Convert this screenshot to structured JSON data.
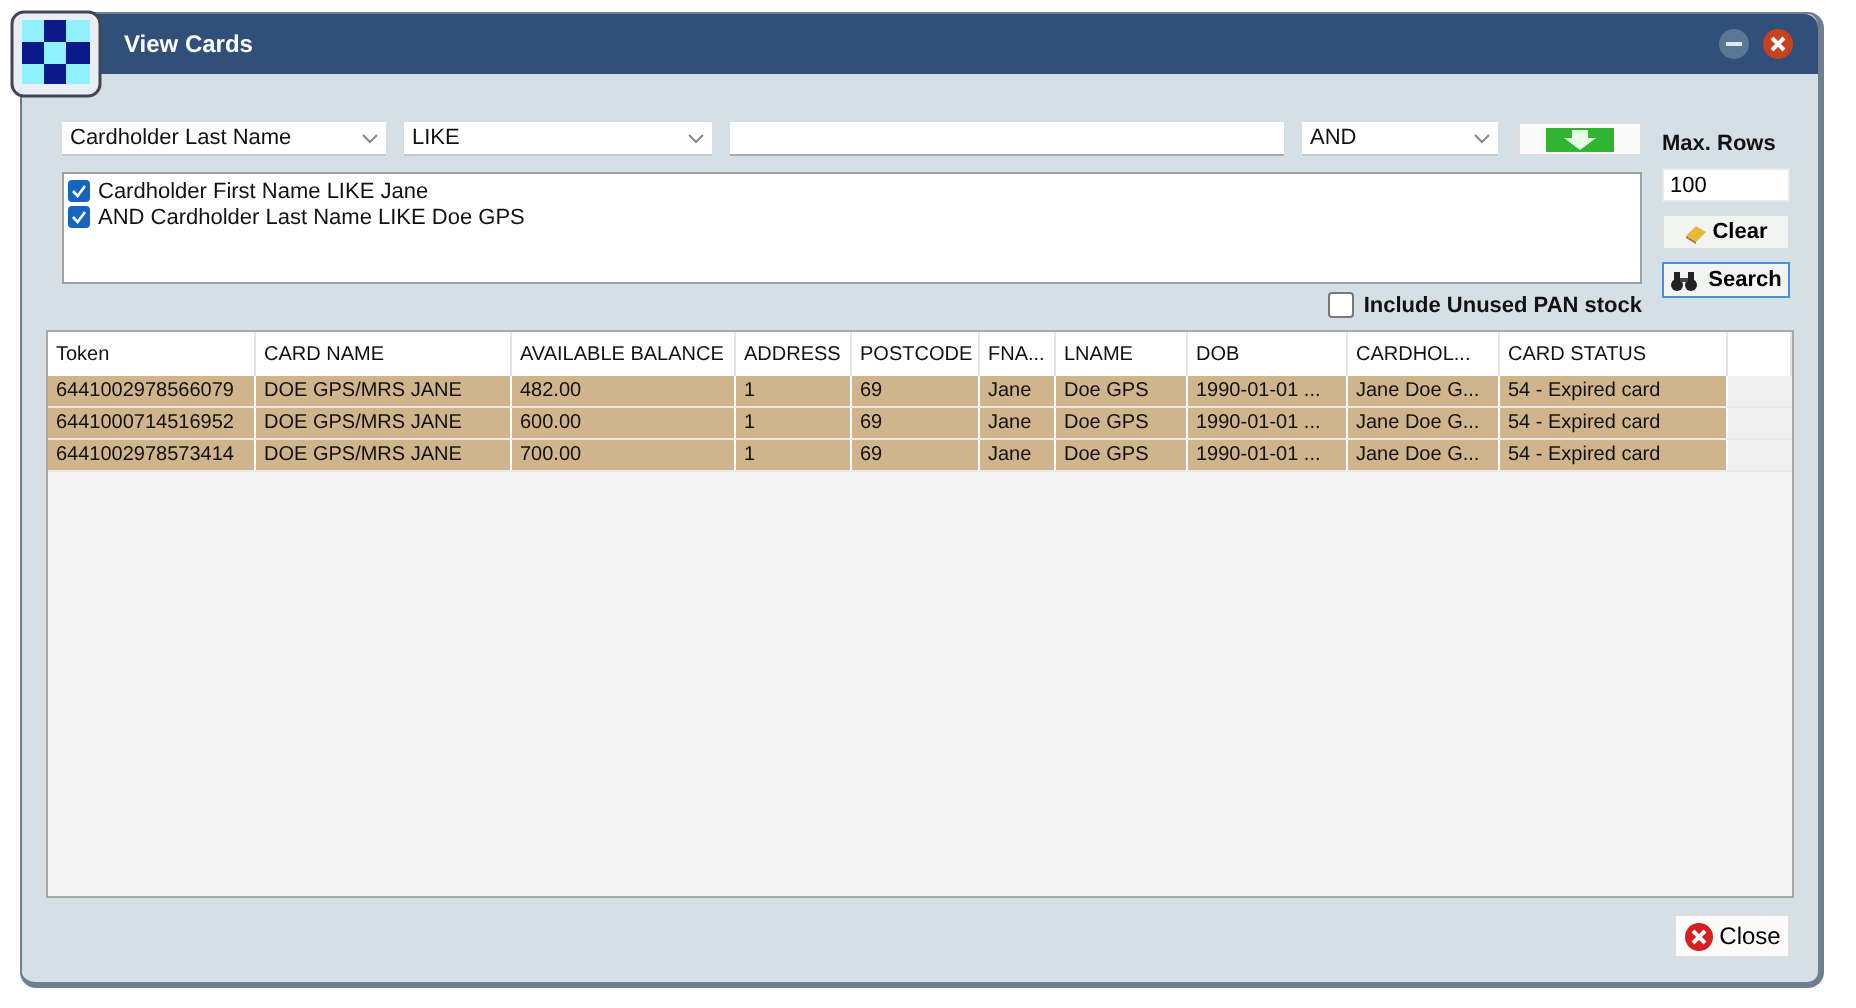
{
  "window": {
    "title": "View Cards"
  },
  "filter": {
    "field": "Cardholder Last Name",
    "operator": "LIKE",
    "join": "AND"
  },
  "conditions": [
    {
      "text": "Cardholder First Name LIKE Jane",
      "checked": true
    },
    {
      "text": "AND  Cardholder Last Name LIKE Doe GPS",
      "checked": true
    }
  ],
  "max_rows": {
    "label": "Max. Rows",
    "value": "100"
  },
  "clear_button": "Clear",
  "include_unused": {
    "label": "Include Unused PAN stock",
    "checked": false
  },
  "search_button": "Search",
  "table": {
    "columns": [
      "Token",
      "CARD NAME",
      "AVAILABLE BALANCE",
      "ADDRESS",
      "POSTCODE",
      "FNA...",
      "LNAME",
      "DOB",
      "CARDHOL...",
      "CARD STATUS"
    ],
    "rows": [
      {
        "selected": true,
        "cells": [
          "6441002978566079",
          "DOE GPS/MRS JANE",
          "482.00",
          "1",
          "69",
          "Jane",
          "Doe GPS",
          "1990-01-01 ...",
          "Jane Doe G...",
          "54 - Expired card"
        ]
      },
      {
        "selected": true,
        "cells": [
          "6441000714516952",
          "DOE GPS/MRS JANE",
          "600.00",
          "1",
          "69",
          "Jane",
          "Doe GPS",
          "1990-01-01 ...",
          "Jane Doe G...",
          "54 - Expired card"
        ]
      },
      {
        "selected": true,
        "cells": [
          "6441002978573414",
          "DOE GPS/MRS JANE",
          "700.00",
          "1",
          "69",
          "Jane",
          "Doe GPS",
          "1990-01-01 ...",
          "Jane Doe G...",
          "54 - Expired card"
        ]
      }
    ]
  },
  "close_button": "Close"
}
